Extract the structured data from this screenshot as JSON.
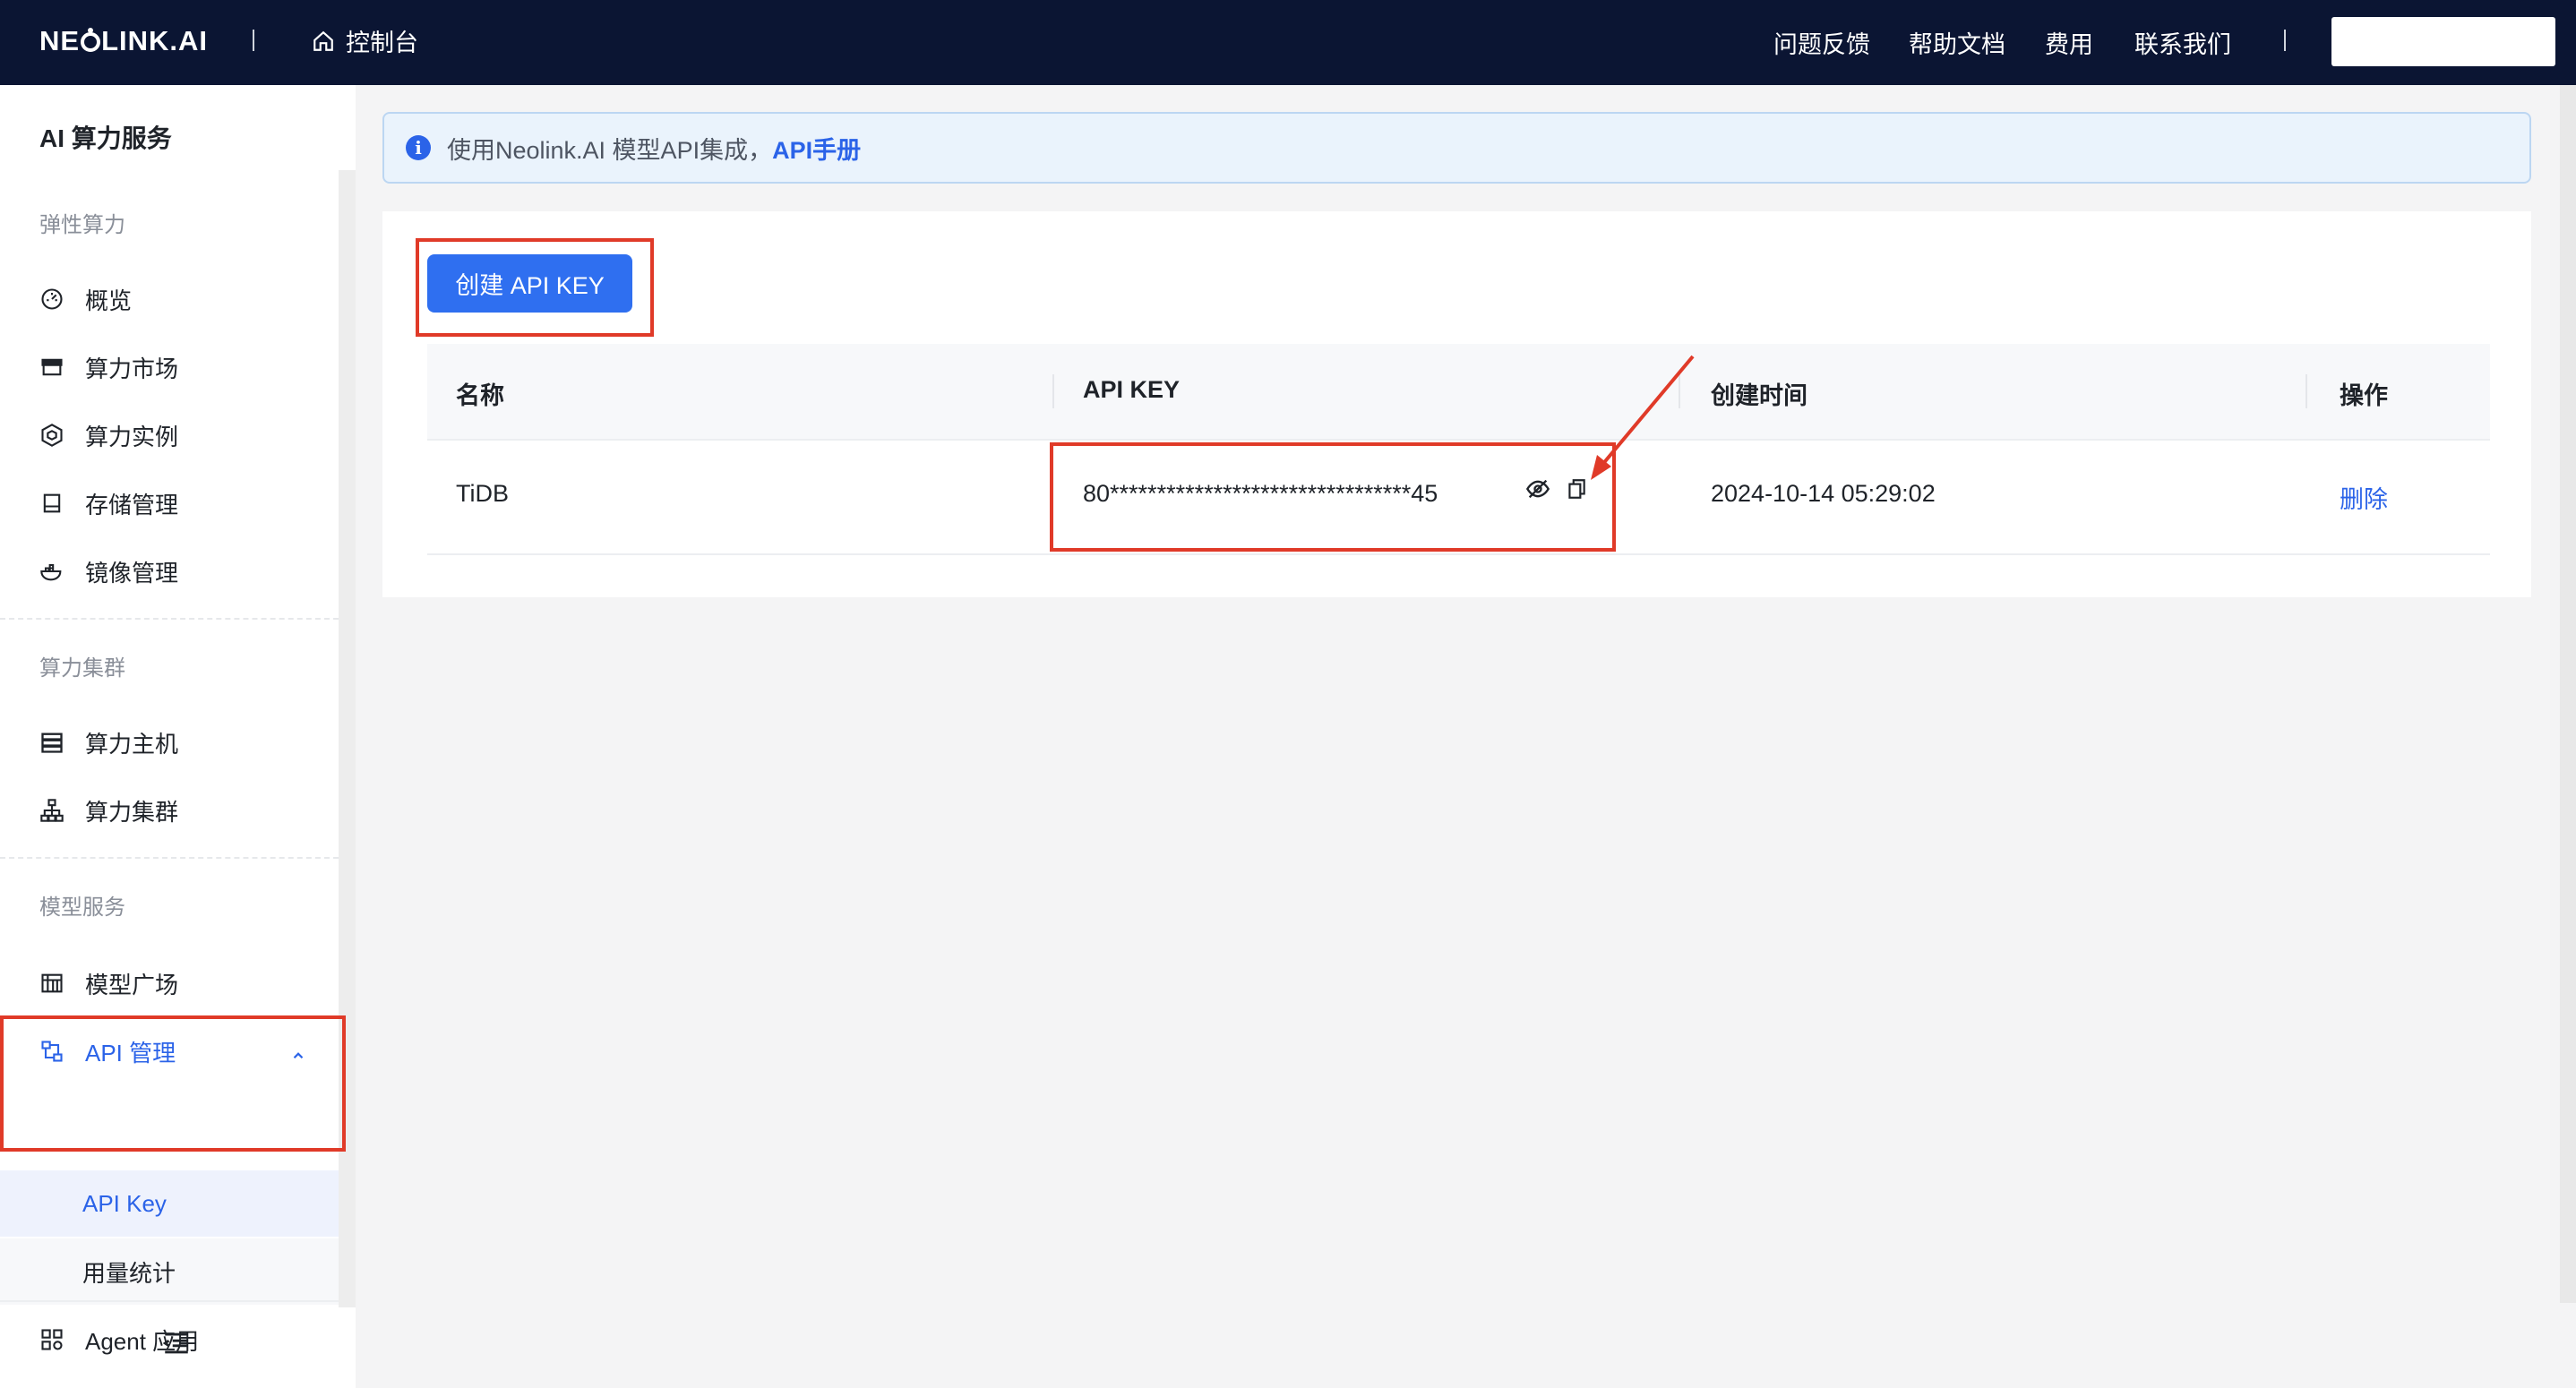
{
  "topbar": {
    "logo": "NEOLINK.AI",
    "console": "控制台",
    "nav": [
      "问题反馈",
      "帮助文档",
      "费用",
      "联系我们"
    ]
  },
  "sidebar": {
    "title": "AI 算力服务",
    "groups": [
      {
        "label": "弹性算力",
        "items": [
          "概览",
          "算力市场",
          "算力实例",
          "存储管理",
          "镜像管理"
        ]
      },
      {
        "label": "算力集群",
        "items": [
          "算力主机",
          "算力集群"
        ]
      },
      {
        "label": "模型服务",
        "items": [
          "模型广场",
          "API 管理",
          "Agent 应用"
        ]
      }
    ],
    "api_sub": [
      "API Key",
      "用量统计"
    ]
  },
  "info": {
    "text": "使用Neolink.AI 模型API集成，",
    "link": "API手册"
  },
  "actions": {
    "create_label": "创建 API KEY"
  },
  "table": {
    "headers": [
      "名称",
      "API KEY",
      "创建时间",
      "操作"
    ],
    "rows": [
      {
        "name": "TiDB",
        "key": "80********************************45",
        "created": "2024-10-14 05:29:02",
        "action": "删除"
      }
    ]
  },
  "colors": {
    "topbar": "#0b1533",
    "accent": "#2b63e8",
    "annotation": "#e03a28"
  }
}
